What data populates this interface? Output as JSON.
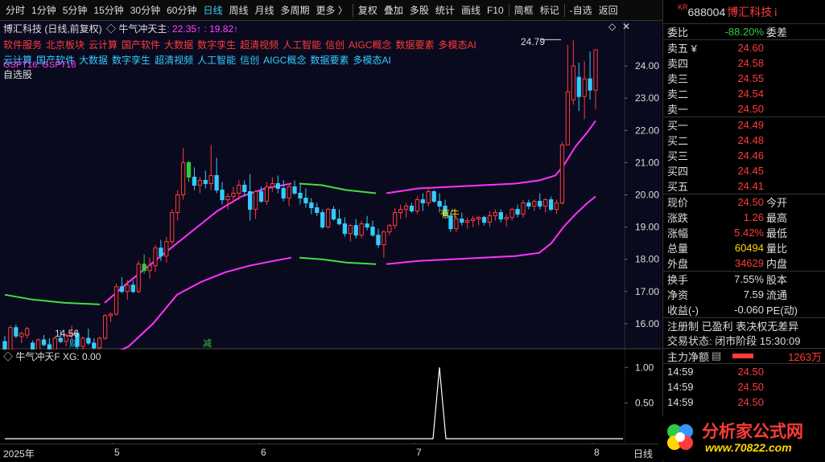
{
  "toolbar": {
    "items": [
      "分时",
      "1分钟",
      "5分钟",
      "15分钟",
      "30分钟",
      "60分钟",
      "日线",
      "周线",
      "月线",
      "多周期",
      "更多 〉",
      "复权",
      "叠加",
      "多股",
      "统计",
      "画线",
      "F10",
      "简框",
      "标记",
      "-自选",
      "返回"
    ],
    "active_index": 6
  },
  "chart": {
    "title": "博汇科技 (日线,前复权)",
    "indicator_name": "牛气冲天主",
    "indicator_val1": ": 22.35↑",
    "indicator_val2": ": 19.82↑",
    "concepts_red": [
      "软件服务",
      "北京板块",
      "云计算",
      "国产软件",
      "大数据",
      "数字孪生",
      "超清视频",
      "人工智能",
      "信创",
      "AIGC概念",
      "数据要素",
      "多模态AI"
    ],
    "concepts_cyan": [
      "云计算",
      "国产软件",
      "大数据",
      "数字孪生",
      "超清视频",
      "人工智能",
      "信创",
      "AIGC概念",
      "数据要素",
      "多模态AI"
    ],
    "gspt": "GSPT16: GSPT18",
    "zixuan": "自选股",
    "high_label": "24.79",
    "low_label": "14.56",
    "marker_cai": "财",
    "marker_jian": "减",
    "marker_youniu": "有牛",
    "price_ticks": [
      "24.00",
      "23.00",
      "22.00",
      "21.00",
      "20.00",
      "19.00",
      "18.00",
      "17.00",
      "16.00"
    ],
    "sub_title": "牛气冲天F",
    "sub_xg": "XG: 0.00",
    "sub_ticks": [
      "1.00",
      "0.50"
    ],
    "x_labels": [
      "2025年",
      "5",
      "6",
      "7",
      "8"
    ],
    "period_label": "日线"
  },
  "chart_data": {
    "type": "candlestick",
    "title": "博汇科技 (日线,前复权)",
    "ylim": [
      15.3,
      24.9
    ],
    "high": 24.79,
    "low": 14.56,
    "indicator_subchart": {
      "name": "牛气冲天F",
      "XG": 0.0,
      "ylim": [
        0,
        1.0
      ],
      "spike_value": 1.0,
      "spike_month": "7"
    }
  },
  "panel": {
    "code": "688004",
    "name": "博汇科技",
    "weibi_label": "委比",
    "weibi_value": "-88.20%",
    "weicha_label": "委差",
    "sell": [
      {
        "label": "卖五 ¥",
        "price": "24.60"
      },
      {
        "label": "卖四",
        "price": "24.58"
      },
      {
        "label": "卖三",
        "price": "24.55"
      },
      {
        "label": "卖二",
        "price": "24.54"
      },
      {
        "label": "卖一",
        "price": "24.50"
      }
    ],
    "buy": [
      {
        "label": "买一",
        "price": "24.49"
      },
      {
        "label": "买二",
        "price": "24.48"
      },
      {
        "label": "买三",
        "price": "24.46"
      },
      {
        "label": "买四",
        "price": "24.45"
      },
      {
        "label": "买五",
        "price": "24.41"
      }
    ],
    "stats": [
      {
        "l1": "现价",
        "v1": "24.50",
        "c1": "red",
        "l2": "今开"
      },
      {
        "l1": "涨跌",
        "v1": "1.26",
        "c1": "red",
        "l2": "最高"
      },
      {
        "l1": "涨幅",
        "v1": "5.42%",
        "c1": "red",
        "l2": "最低"
      },
      {
        "l1": "总量",
        "v1": "60494",
        "c1": "yellow",
        "l2": "量比"
      },
      {
        "l1": "外盘",
        "v1": "34629",
        "c1": "red",
        "l2": "内盘"
      }
    ],
    "stats2": [
      {
        "l1": "换手",
        "v1": "7.55%",
        "l2": "股本"
      },
      {
        "l1": "净资",
        "v1": "7.59",
        "l2": "流通"
      },
      {
        "l1": "收益(-)",
        "v1": "-0.060",
        "l2": "PE(动)"
      }
    ],
    "tags": "注册制 已盈利 表决权无差异",
    "status": "交易状态: 闭市阶段 15:30:09",
    "zhuli_label": "主力净额",
    "zhuli_value": "1263万",
    "ticks": [
      {
        "time": "14:59",
        "price": "24.50"
      },
      {
        "time": "14:59",
        "price": "24.50"
      },
      {
        "time": "14:59",
        "price": "24.50"
      }
    ],
    "watermark": "分析家公式网",
    "watermark_url": "www.70822.com"
  }
}
